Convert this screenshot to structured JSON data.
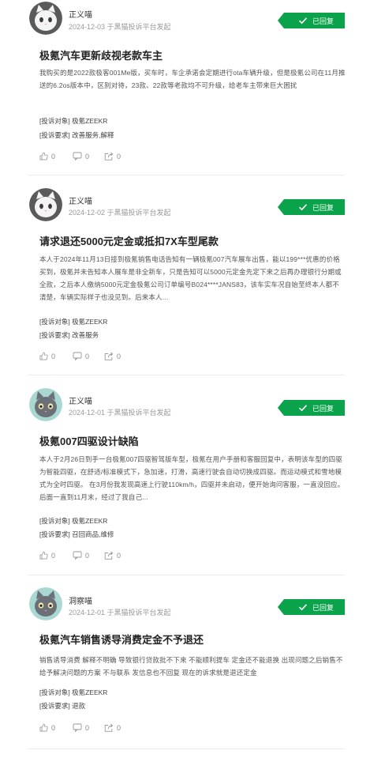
{
  "complaints": [
    {
      "author": "正义喵",
      "meta": "2024-12-03 于黑猫投诉平台发起",
      "status": "已回复",
      "title": "极氪汽车更新歧视老款车主",
      "content": "我购买的是2022款极客001Me版，买车时，车企承诺会定期进行ota车辆升级，但是极氪公司在11月推送的6.2os版本中，区别对待，23款、22款等老款均不可升级，给老车主带来巨大困扰",
      "target_label": "[投诉对象]",
      "target_value": "极氪ZEEKR",
      "demand_label": "[投诉要求]",
      "demand_value": "改善服务,解释",
      "likes": "0",
      "comments": "0",
      "shares": "0",
      "avatar": "white-gray-cat"
    },
    {
      "author": "正义喵",
      "meta": "2024-12-02 于黑猫投诉平台发起",
      "status": "已回复",
      "title": "请求退还5000元定金或抵扣7X车型尾款",
      "content": "本人于2024年11月13日接到极氪销售电话告知有一辆极氪007汽车展车出售，能以199***优惠的价格买到，极氪并未告知本人展车是非全新车，只是告知可以5000元定金先定下来之后再办理银行分期或全款，之后本人缴纳5000元定金极氪公司订单编号B024****JANS83，该车实车况自始至终本人都不清楚，车辆实际样子也没见到。后来本人...",
      "target_label": "[投诉对象]",
      "target_value": "极氪ZEEKR",
      "demand_label": "[投诉要求]",
      "demand_value": "改善服务",
      "likes": "0",
      "comments": "0",
      "shares": "0",
      "avatar": "white-gray-cat"
    },
    {
      "author": "正义喵",
      "meta": "2024-12-01 于黑猫投诉平台发起",
      "status": "已回复",
      "title": "极氪007四驱设计缺陷",
      "content": "本人于2月26日到手一台极氪007四驱智驾版车型，极氪在用户手册和客服回复中，表明该车型的四驱为智能四驱，在舒适/标准模式下，急加速，打滑，高速行驶会自动切换成四驱。而运动模式和雪地模式为全时四驱。 在3月份我发现高速上行驶110km/h，四驱并未启动，便开始询问客服，一直没回应。后面一直到11月末，经过了我自己...",
      "target_label": "[投诉对象]",
      "target_value": "极氪ZEEKR",
      "demand_label": "[投诉要求]",
      "demand_value": "召回商品,维修",
      "likes": "0",
      "comments": "0",
      "shares": "0",
      "avatar": "gray-cat-teal"
    },
    {
      "author": "洞察喵",
      "meta": "2024-12-01 于黑猫投诉平台发起",
      "status": "已回复",
      "title": "极氪汽车销售诱导消费定金不予退还",
      "content": "销售诱导消费 解释不明确 导致银行贷款批不下来 不能顺利提车 定金还不能退换 出现问题之后销售不给予解决问题的方案 不与联系 发信息也不回复 现在的诉求就是退还定金",
      "target_label": "[投诉对象]",
      "target_value": "极氪ZEEKR",
      "demand_label": "[投诉要求]",
      "demand_value": "退款",
      "likes": "0",
      "comments": "0",
      "shares": "0",
      "avatar": "gray-cat-teal"
    }
  ],
  "colors": {
    "badge": "#0aa24a",
    "meta": "#999999",
    "title": "#222222"
  },
  "icons": [
    "check-icon",
    "like-icon",
    "comment-icon",
    "share-icon"
  ]
}
